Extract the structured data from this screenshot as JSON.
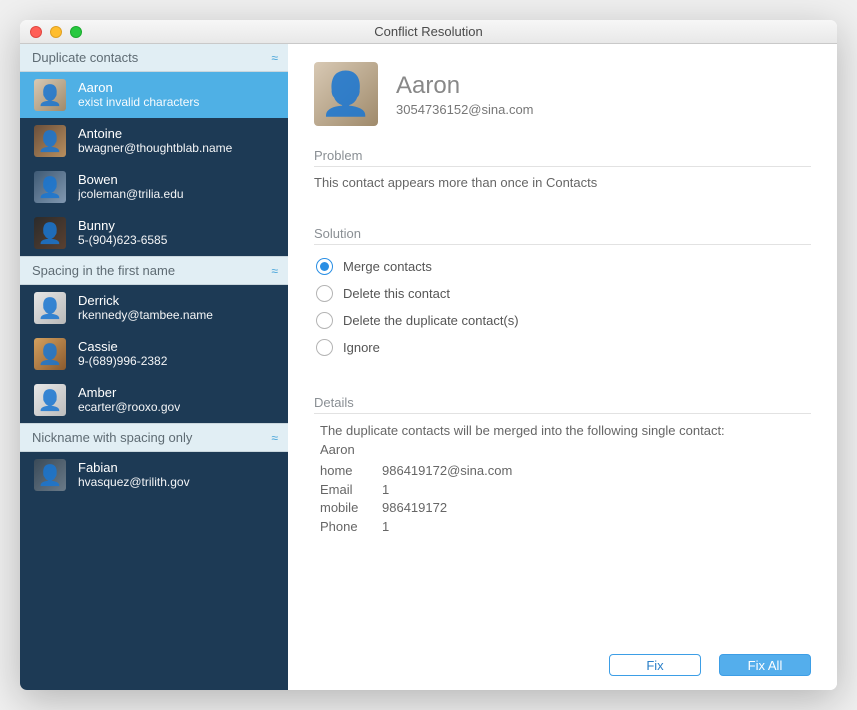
{
  "window": {
    "title": "Conflict Resolution"
  },
  "sections": [
    {
      "label": "Duplicate contacts",
      "items": [
        {
          "name": "Aaron",
          "sub": "exist invalid characters",
          "avatar_class": "av-a",
          "selected": true
        },
        {
          "name": "Antoine",
          "sub": "bwagner@thoughtblab.name",
          "avatar_class": "av-b",
          "selected": false
        },
        {
          "name": "Bowen",
          "sub": "jcoleman@trilia.edu",
          "avatar_class": "av-c",
          "selected": false
        },
        {
          "name": "Bunny",
          "sub": "5-(904)623-6585",
          "avatar_class": "av-d",
          "selected": false
        }
      ]
    },
    {
      "label": "Spacing in the first name",
      "items": [
        {
          "name": "Derrick",
          "sub": "rkennedy@tambee.name",
          "avatar_class": "av-e",
          "selected": false
        },
        {
          "name": "Cassie",
          "sub": "9-(689)996-2382",
          "avatar_class": "av-f",
          "selected": false
        },
        {
          "name": "Amber",
          "sub": "ecarter@rooxo.gov",
          "avatar_class": "av-g",
          "selected": false
        }
      ]
    },
    {
      "label": "Nickname with spacing only",
      "items": [
        {
          "name": "Fabian",
          "sub": "hvasquez@trilith.gov",
          "avatar_class": "av-h",
          "selected": false
        }
      ]
    }
  ],
  "main": {
    "name": "Aaron",
    "email": "3054736152@sina.com",
    "problem_label": "Problem",
    "problem_text": "This contact appears more than once in Contacts",
    "solution_label": "Solution",
    "solutions": [
      {
        "label": "Merge contacts",
        "checked": true
      },
      {
        "label": "Delete this contact",
        "checked": false
      },
      {
        "label": "Delete the duplicate contact(s)",
        "checked": false
      },
      {
        "label": "Ignore",
        "checked": false
      }
    ],
    "details_label": "Details",
    "details_intro": "The duplicate contacts will be merged into the following single contact:",
    "details_name": "Aaron",
    "details_rows": [
      {
        "label": "home",
        "value": "986419172@sina.com"
      },
      {
        "label": "Email",
        "value": "1"
      },
      {
        "label": "mobile",
        "value": "986419172"
      },
      {
        "label": "Phone",
        "value": "1"
      }
    ]
  },
  "buttons": {
    "fix": "Fix",
    "fix_all": "Fix All"
  }
}
